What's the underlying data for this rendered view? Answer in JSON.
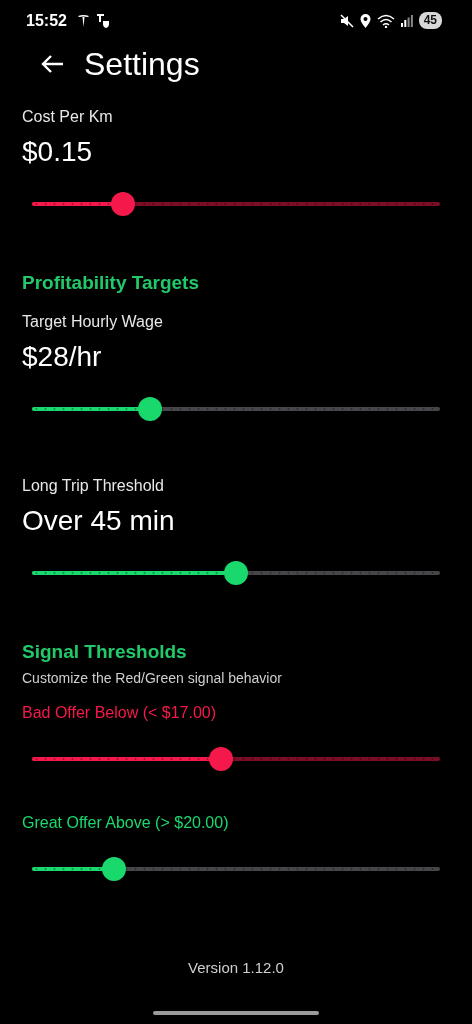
{
  "status_bar": {
    "time": "15:52",
    "battery": "45"
  },
  "header": {
    "title": "Settings"
  },
  "items": [
    {
      "kind": "slider",
      "label": "Cost Per Km",
      "value": "$0.15",
      "level": 0.224,
      "color": "#f5194b",
      "track_tinted": true,
      "label_colored": false
    },
    {
      "kind": "section",
      "title": "Profitability Targets"
    },
    {
      "kind": "slider",
      "label": "Target Hourly Wage",
      "value": "$28/hr",
      "level": 0.29,
      "color": "#19d96d",
      "track_tinted": false,
      "label_colored": false
    },
    {
      "kind": "slider",
      "label": "Long Trip Threshold",
      "value": "Over 45 min",
      "level": 0.5,
      "color": "#19d96d",
      "track_tinted": false,
      "label_colored": false
    },
    {
      "kind": "section",
      "title": "Signal Thresholds",
      "subtitle": "Customize the Red/Green signal behavior"
    },
    {
      "kind": "slider",
      "label": "Bad Offer Below (< $17.00)",
      "level": 0.464,
      "color": "#f5194b",
      "track_tinted": true,
      "label_colored": true
    },
    {
      "kind": "slider",
      "label": "Great Offer Above (> $20.00)",
      "level": 0.2,
      "color": "#19d96d",
      "track_tinted": false,
      "label_colored": true
    }
  ],
  "footer": {
    "version": "Version 1.12.0"
  }
}
